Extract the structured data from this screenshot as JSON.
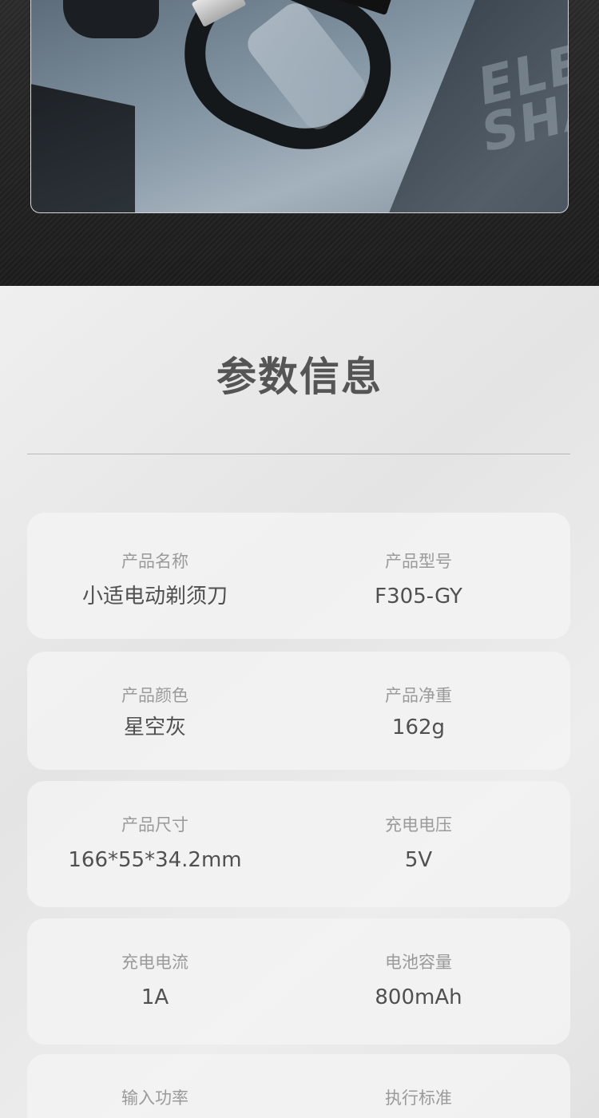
{
  "section": {
    "title": "参数信息"
  },
  "specs": [
    {
      "left": {
        "label": "产品名称",
        "value": "小适电动剃须刀"
      },
      "right": {
        "label": "产品型号",
        "value": "F305-GY"
      }
    },
    {
      "left": {
        "label": "产品颜色",
        "value": "星空灰"
      },
      "right": {
        "label": "产品净重",
        "value": "162g"
      }
    },
    {
      "left": {
        "label": "产品尺寸",
        "value": "166*55*34.2mm"
      },
      "right": {
        "label": "充电电压",
        "value": "5V"
      }
    },
    {
      "left": {
        "label": "充电电流",
        "value": "1A"
      },
      "right": {
        "label": "电池容量",
        "value": "800mAh"
      }
    },
    {
      "left": {
        "label": "输入功率",
        "value": ""
      },
      "right": {
        "label": "执行标准",
        "value": ""
      }
    }
  ],
  "hero": {
    "package_text": "ELE SHA"
  }
}
